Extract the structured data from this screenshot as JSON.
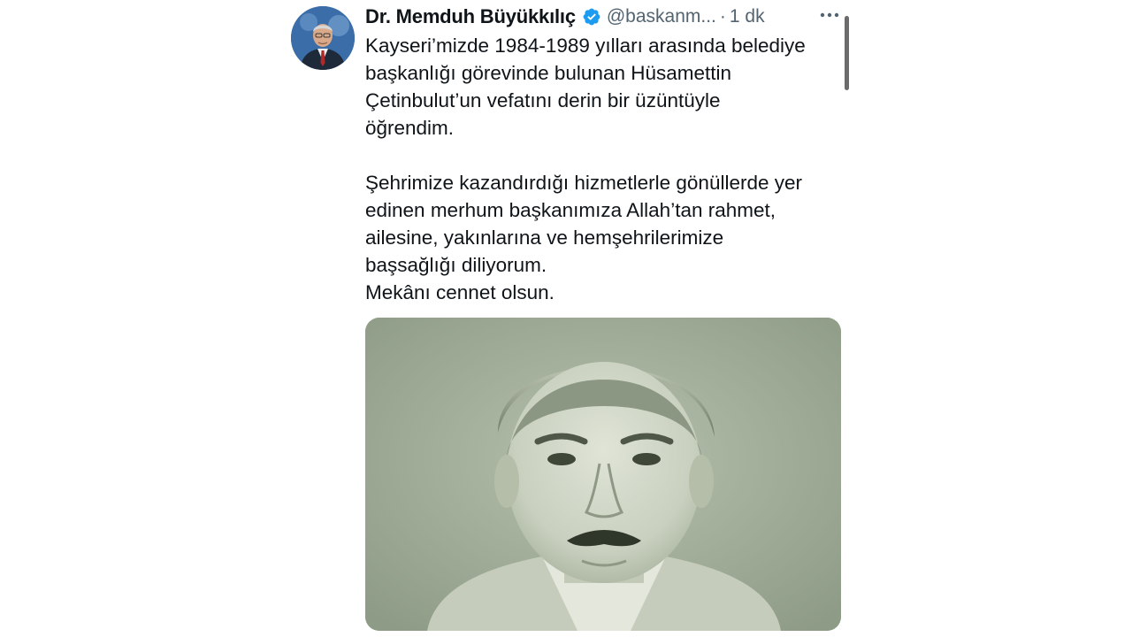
{
  "tweet": {
    "author_name": "Dr. Memduh Büyükkılıç",
    "handle": "@baskanm...",
    "separator": "·",
    "time": "1 dk",
    "verified": true,
    "text_lines_1": [
      "Kayseri’mizde 1984-1989 yılları arasında belediye",
      "başkanlığı görevinde bulunan Hüsamettin",
      "Çetinbulut’un vefatını derin bir üzüntüyle",
      "öğrendim."
    ],
    "text_lines_2": [
      "Şehrimize kazandırdığı hizmetlerle gönüllerde yer",
      "edinen merhum başkanımıza Allah’tan rahmet,",
      "ailesine, yakınlarına ve hemşehrilerimize",
      "başsağlığı diliyorum.",
      "Mekânı cennet olsun."
    ]
  },
  "icons": {
    "verified": "verified-badge-icon",
    "more": "more-options-icon"
  },
  "colors": {
    "text": "#0f1419",
    "secondary": "#536471",
    "verified_blue": "#1d9bf0",
    "photo_tint": "#a3b09a"
  }
}
